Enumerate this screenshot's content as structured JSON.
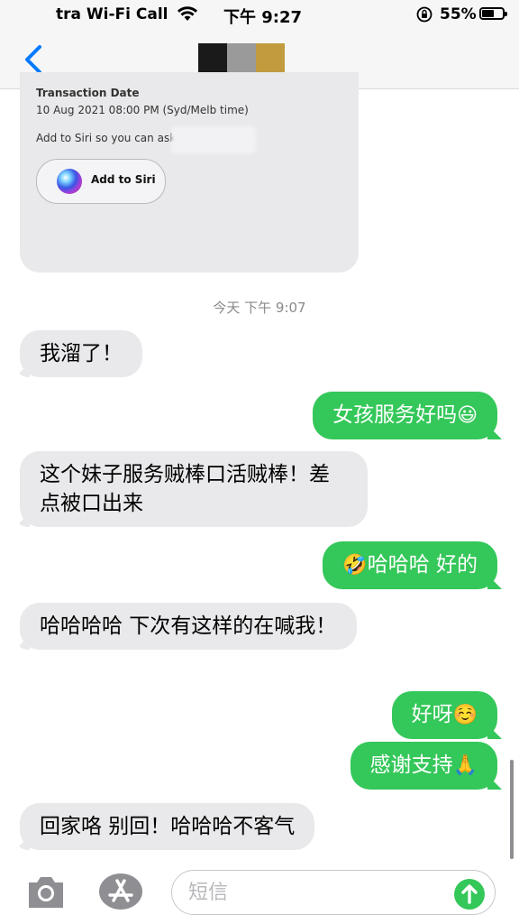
{
  "status_bar": {
    "carrier": "tra Wi-Fi Call",
    "time": "下午 9:27",
    "battery": "55%"
  },
  "header": {
    "back_icon": "chevron-left-icon",
    "avatar_colors": [
      "#1a1a1a",
      "#9a9a9a",
      "#c39b3f"
    ]
  },
  "card": {
    "label": "Transaction Date",
    "date": "10 Aug 2021 08:00 PM (Syd/Melb time)",
    "siri_prompt": "Add to Siri so you can ask",
    "siri_button": "Add to Siri"
  },
  "timestamp": "今天 下午 9:07",
  "messages": [
    {
      "dir": "in",
      "text": "我溜了！"
    },
    {
      "dir": "out",
      "text": "女孩服务好吗",
      "emoji": "😃"
    },
    {
      "dir": "in",
      "text": "这个妹子服务贼棒口活贼棒！差点被口出来"
    },
    {
      "dir": "out",
      "text": "哈哈哈 好的",
      "emoji": "🤣"
    },
    {
      "dir": "in",
      "text": "哈哈哈哈  下次有这样的在喊我！"
    },
    {
      "dir": "out",
      "text": "好呀",
      "emoji": "☺️"
    },
    {
      "dir": "out",
      "text": "感谢支持",
      "emoji": "🙏"
    },
    {
      "dir": "in",
      "text": "回家咯  别回！哈哈哈不客气"
    }
  ],
  "input": {
    "placeholder": "短信"
  },
  "colors": {
    "accent": "#007aff",
    "outgoing": "#34c759",
    "incoming": "#e9e9eb"
  }
}
